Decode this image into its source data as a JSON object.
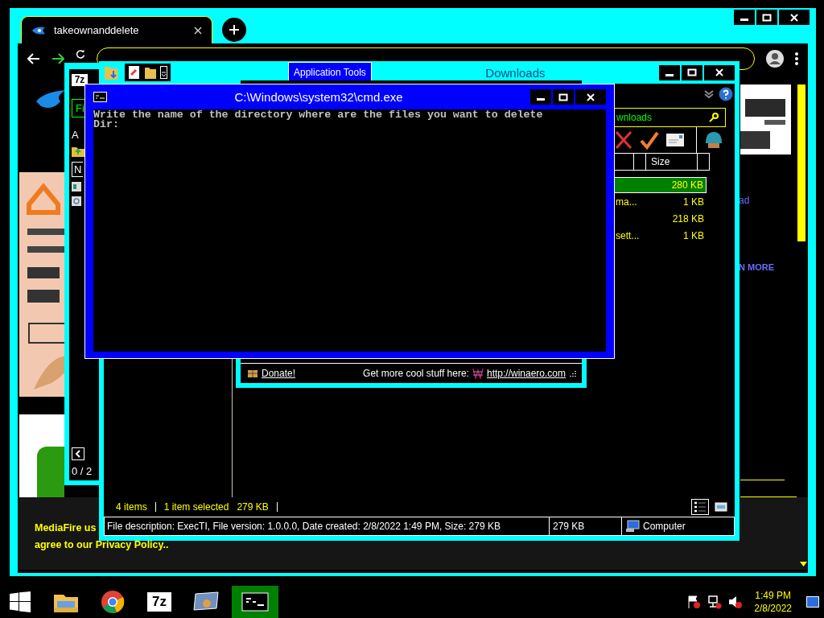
{
  "browser": {
    "tab": {
      "title": "takeownanddelete"
    },
    "page": {
      "ad_link": "ad",
      "learn_more": "N MORE",
      "cookie_notice": [
        "MediaFire us",
        "agree to our Privacy Policy.."
      ]
    }
  },
  "archive_window": {
    "icon_label": "7z",
    "menu": "Fi",
    "item": "A",
    "column": "N",
    "status": "0 / 2"
  },
  "explorer": {
    "ribbon_tab": "Application Tools",
    "title": "Downloads",
    "search": {
      "value": "wnloads"
    },
    "columns": [
      "Size"
    ],
    "files": [
      {
        "size": "280 KB",
        "selected": true
      },
      {
        "name": "ma...",
        "size": "1 KB",
        "selected": false
      },
      {
        "size": "218 KB",
        "selected": false
      },
      {
        "name": "sett...",
        "size": "1 KB",
        "selected": false
      }
    ],
    "status": {
      "items": "4 items",
      "selection": "1 item selected",
      "selection_size": "279 KB"
    },
    "views": [
      {
        "kind": "details",
        "selected": true
      },
      {
        "kind": "preview",
        "selected": false
      }
    ],
    "details": {
      "description": "File description: ExecTI, File version: 1.0.0.0, Date created: 2/8/2022 1:49 PM, Size: 279 KB",
      "size": "279 KB",
      "location": "Computer"
    }
  },
  "winaero": {
    "donate": "Donate!",
    "promo": "Get more cool stuff here:",
    "link": "http://winaero.com"
  },
  "console": {
    "title": "C:\\Windows\\system32\\cmd.exe",
    "lines": [
      "Write the name of the directory where are the files you want to delete",
      "Dir:"
    ]
  },
  "taskbar": {
    "apps": [
      {
        "kind": "explorer",
        "selected": false
      },
      {
        "kind": "browser",
        "selected": false
      },
      {
        "kind": "archiver",
        "label": "7z",
        "selected": false
      },
      {
        "kind": "display",
        "selected": false
      },
      {
        "kind": "console",
        "selected": true
      }
    ],
    "clock": {
      "time": "1:49 PM",
      "date": "2/8/2022"
    }
  }
}
